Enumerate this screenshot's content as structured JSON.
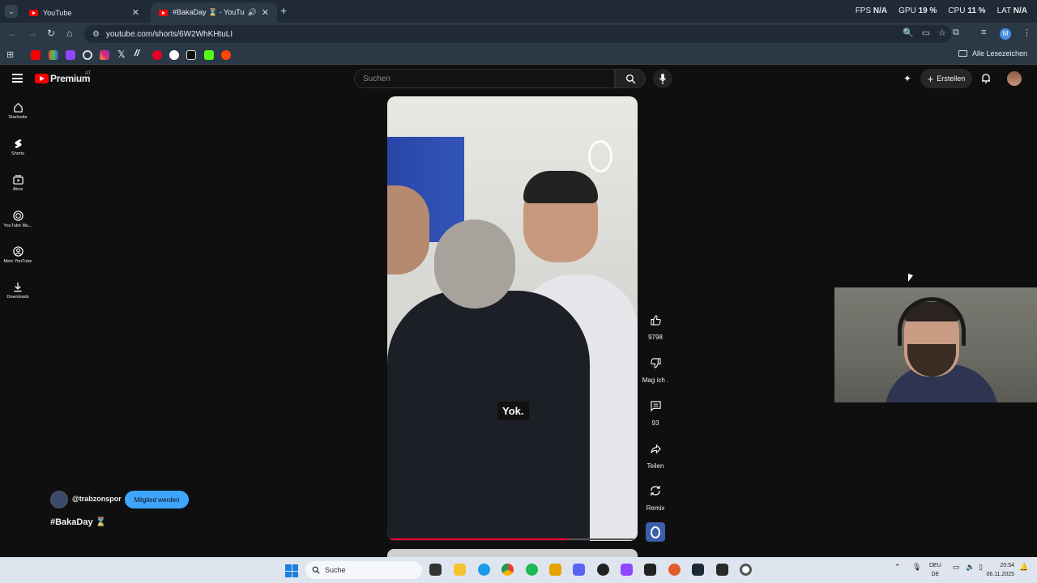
{
  "browser": {
    "tabs": [
      {
        "title": "YouTube",
        "active": false
      },
      {
        "title": "#BakaDay ⌛ - YouTube",
        "active": true
      }
    ],
    "url": "youtube.com/shorts/6W2WhKHtuLI",
    "bookmarks_folder": "Alle Lesezeichen",
    "profile_initial": "M",
    "overlay": {
      "fps_label": "FPS",
      "fps_value": "N/A",
      "gpu_label": "GPU",
      "gpu_value": "19 %",
      "cpu_label": "CPU",
      "cpu_value": "11 %",
      "lat_label": "LAT",
      "lat_value": "N/A"
    },
    "bookmark_icons": [
      "youtube-icon",
      "stats-icon",
      "twitch-icon",
      "xbox-icon",
      "instagram-icon",
      "x-icon",
      "slash-icon",
      "pinterest-icon",
      "threads-icon",
      "tiktok-icon",
      "kick-icon",
      "reddit-icon"
    ]
  },
  "youtube": {
    "brand": "Premium",
    "brand_sup": "AT",
    "search_placeholder": "Suchen",
    "create_label": "Erstellen",
    "sidebar": [
      {
        "label": "Startseite",
        "icon": "home-icon"
      },
      {
        "label": "Shorts",
        "icon": "shorts-icon"
      },
      {
        "label": "Abos",
        "icon": "subscriptions-icon"
      },
      {
        "label": "YouTube Mu...",
        "icon": "youtube-music-icon"
      },
      {
        "label": "Mein YouTube",
        "icon": "my-youtube-icon"
      },
      {
        "label": "Downloads",
        "icon": "download-icon"
      }
    ],
    "short": {
      "caption": "Yok.",
      "progress": 0.73,
      "channel": "@trabzonspor",
      "member_label": "Mitglied werden",
      "title": "#BakaDay ⌛"
    },
    "actions": {
      "like_count": "9798",
      "dislike_label": "Mag ich .",
      "comment_count": "93",
      "share_label": "Teilen",
      "remix_label": "Remix"
    }
  },
  "taskbar": {
    "search_placeholder": "Suche",
    "lang_top": "DEU",
    "lang_bottom": "DE",
    "time": "20:54",
    "date": "06.11.2025"
  },
  "colors": {
    "accent_red": "#ff0033",
    "member_blue": "#3ea6ff",
    "chrome_bg": "#2b3947"
  }
}
